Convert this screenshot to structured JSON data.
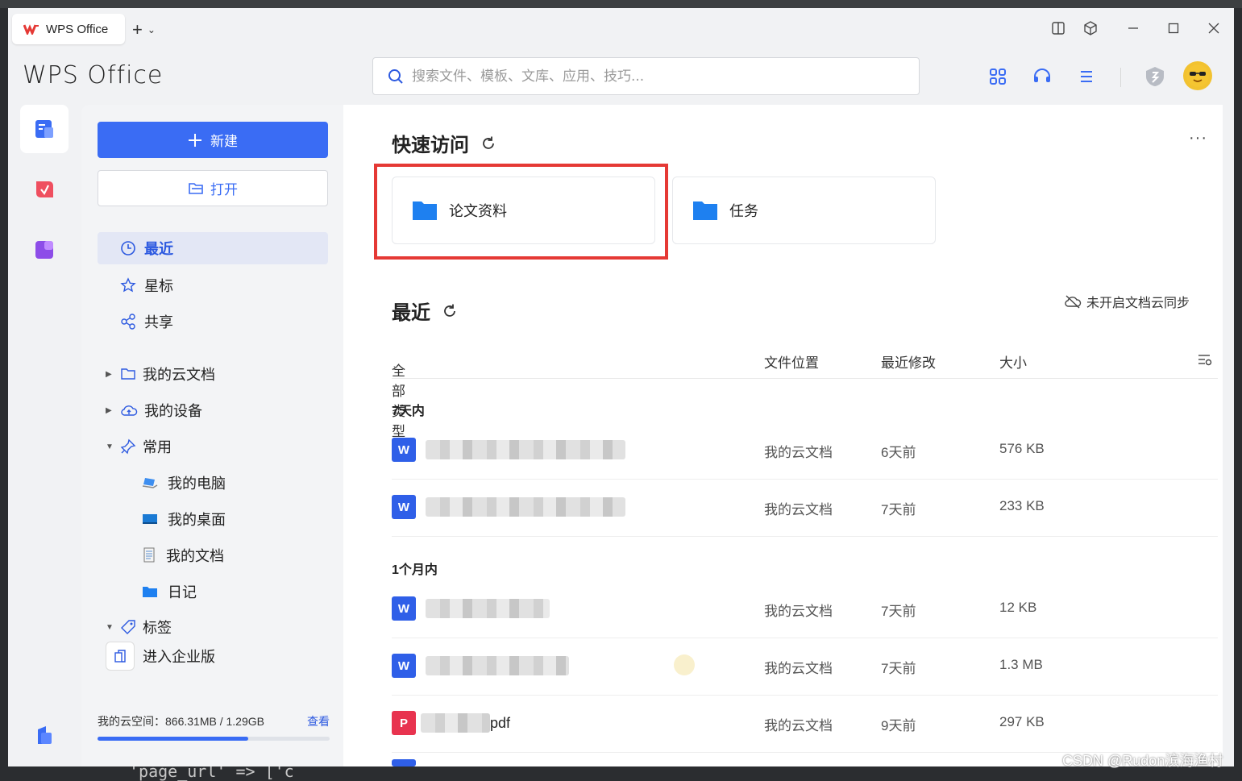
{
  "tab": {
    "title": "WPS Office",
    "new_tab": "+",
    "new_tab_menu": "⌄"
  },
  "app": {
    "brand": "WPS Office"
  },
  "search": {
    "placeholder": "搜索文件、模板、文库、应用、技巧..."
  },
  "sidebar": {
    "new_label": "新建",
    "open_label": "打开",
    "nav": [
      {
        "label": "最近",
        "icon": "clock-icon",
        "active": true
      },
      {
        "label": "星标",
        "icon": "star-icon"
      },
      {
        "label": "共享",
        "icon": "share-icon"
      }
    ],
    "tree": [
      {
        "label": "我的云文档",
        "icon": "folder-outline-icon",
        "expanded": false
      },
      {
        "label": "我的设备",
        "icon": "cloud-device-icon",
        "expanded": false
      },
      {
        "label": "常用",
        "icon": "pin-icon",
        "expanded": true
      }
    ],
    "common_items": [
      {
        "label": "我的电脑",
        "icon": "laptop-icon"
      },
      {
        "label": "我的桌面",
        "icon": "desktop-icon"
      },
      {
        "label": "我的文档",
        "icon": "document-icon"
      },
      {
        "label": "日记",
        "icon": "folder-icon"
      }
    ],
    "tags_label": "标签",
    "enterprise_label": "进入企业版",
    "storage": {
      "text": "我的云空间：866.31MB / 1.29GB",
      "link": "查看",
      "used_fraction": 0.65
    }
  },
  "quick_access": {
    "title": "快速访问",
    "items": [
      {
        "label": "论文资料"
      },
      {
        "label": "任务"
      }
    ]
  },
  "recent": {
    "title": "最近",
    "sync_status": "未开启文档云同步",
    "columns": {
      "type_filter": "全部类型",
      "location": "文件位置",
      "modified": "最近修改",
      "size": "大小"
    },
    "groups": [
      {
        "label": "7天内",
        "rows": [
          {
            "type": "W",
            "name_suffix": "",
            "location": "我的云文档",
            "modified": "6天前",
            "size": "576 KB"
          },
          {
            "type": "W",
            "name_suffix": "",
            "location": "我的云文档",
            "modified": "7天前",
            "size": "233 KB"
          }
        ]
      },
      {
        "label": "1个月内",
        "rows": [
          {
            "type": "W",
            "name_suffix": "",
            "location": "我的云文档",
            "modified": "7天前",
            "size": "12 KB"
          },
          {
            "type": "W",
            "name_suffix": "",
            "location": "我的云文档",
            "modified": "7天前",
            "size": "1.3 MB"
          },
          {
            "type": "P",
            "name_suffix": "pdf",
            "location": "我的云文档",
            "modified": "9天前",
            "size": "297 KB"
          }
        ]
      }
    ]
  },
  "watermark": "CSDN @Rudon滨海渔村",
  "background_code": "'page_url' => ['c",
  "colors": {
    "accent": "#3a6cf4",
    "highlight_box": "#e53935",
    "word": "#2f5fe8",
    "pdf": "#e8334f"
  }
}
